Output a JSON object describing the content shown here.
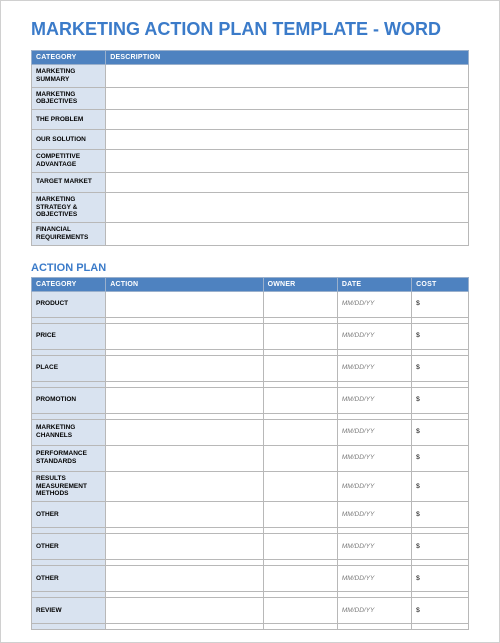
{
  "title": "MARKETING ACTION PLAN TEMPLATE - WORD",
  "table1": {
    "headers": {
      "category": "CATEGORY",
      "description": "DESCRIPTION"
    },
    "rows": [
      {
        "category": "MARKETING SUMMARY",
        "description": ""
      },
      {
        "category": "MARKETING OBJECTIVES",
        "description": ""
      },
      {
        "category": "THE PROBLEM",
        "description": ""
      },
      {
        "category": "OUR SOLUTION",
        "description": ""
      },
      {
        "category": "COMPETITIVE ADVANTAGE",
        "description": ""
      },
      {
        "category": "TARGET MARKET",
        "description": ""
      },
      {
        "category": "MARKETING STRATEGY & OBJECTIVES",
        "description": ""
      },
      {
        "category": "FINANCIAL REQUIREMENTS",
        "description": ""
      }
    ]
  },
  "section2_title": "ACTION PLAN",
  "table2": {
    "headers": {
      "category": "CATEGORY",
      "action": "ACTION",
      "owner": "OWNER",
      "date": "DATE",
      "cost": "COST"
    },
    "date_placeholder": "MM/DD/YY",
    "cost_placeholder": "$",
    "rows": [
      {
        "category": "PRODUCT",
        "action": "",
        "owner": ""
      },
      {
        "category": "PRICE",
        "action": "",
        "owner": ""
      },
      {
        "category": "PLACE",
        "action": "",
        "owner": ""
      },
      {
        "category": "PROMOTION",
        "action": "",
        "owner": ""
      },
      {
        "category": "MARKETING CHANNELS",
        "action": "",
        "owner": ""
      },
      {
        "category": "PERFORMANCE STANDARDS",
        "action": "",
        "owner": ""
      },
      {
        "category": "RESULTS MEASUREMENT METHODS",
        "action": "",
        "owner": ""
      },
      {
        "category": "OTHER",
        "action": "",
        "owner": ""
      },
      {
        "category": "OTHER",
        "action": "",
        "owner": ""
      },
      {
        "category": "OTHER",
        "action": "",
        "owner": ""
      },
      {
        "category": "REVIEW",
        "action": "",
        "owner": ""
      }
    ]
  }
}
